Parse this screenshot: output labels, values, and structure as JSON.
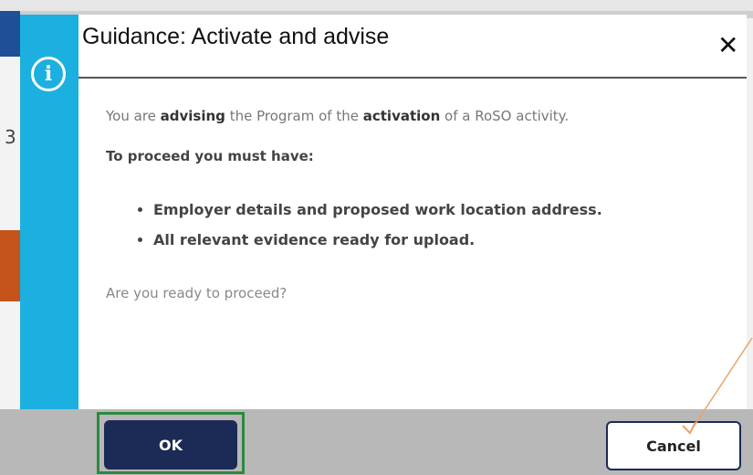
{
  "dialog": {
    "title": "Guidance: Activate and advise",
    "close_symbol": "✕",
    "info_symbol": "i",
    "line1": {
      "p1": "You are ",
      "b1": "advising",
      "p2": " the Program of the ",
      "b2": "activation",
      "p3": " of a RoSO activity."
    },
    "proceed_heading": "To proceed you must have:",
    "requirements": [
      "Employer details and proposed work location address.",
      "All relevant evidence ready for upload."
    ],
    "question": "Are you ready to proceed?",
    "buttons": {
      "ok": "OK",
      "cancel": "Cancel"
    }
  },
  "background": {
    "partial_digit": "3"
  },
  "icons": {
    "info": "info-icon",
    "close": "close-icon"
  },
  "colors": {
    "accent": "#1bb0e0",
    "primary_button": "#1c2b55",
    "highlight_box": "#2b8a3e",
    "annotation_arrow": "#e8a46a"
  }
}
